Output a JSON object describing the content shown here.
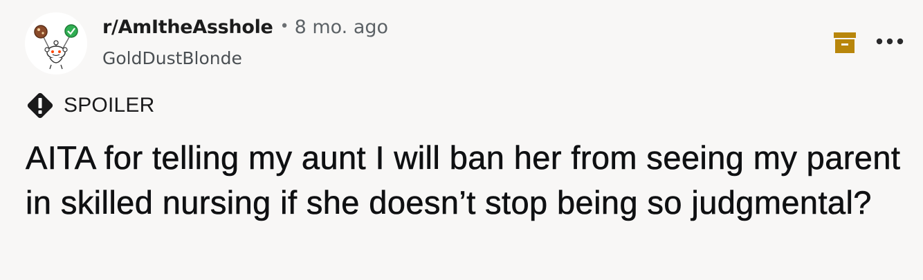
{
  "post": {
    "subreddit": "r/AmItheAsshole",
    "separator": "•",
    "age": "8 mo. ago",
    "author": "GoldDustBlonde",
    "flair": "SPOILER",
    "title": "AITA for telling my aunt I will ban her from seeing my parent in skilled nursing if she doesn’t stop being so judgmental?"
  },
  "icons": {
    "avatar": "snoo-avatar-icon",
    "save": "archive-save-icon",
    "more": "more-options-icon",
    "spoiler": "spoiler-warning-icon"
  },
  "colors": {
    "background": "#f8f7f6",
    "save_icon": "#b8860b",
    "spoiler_badge": "#1a1a1b"
  }
}
